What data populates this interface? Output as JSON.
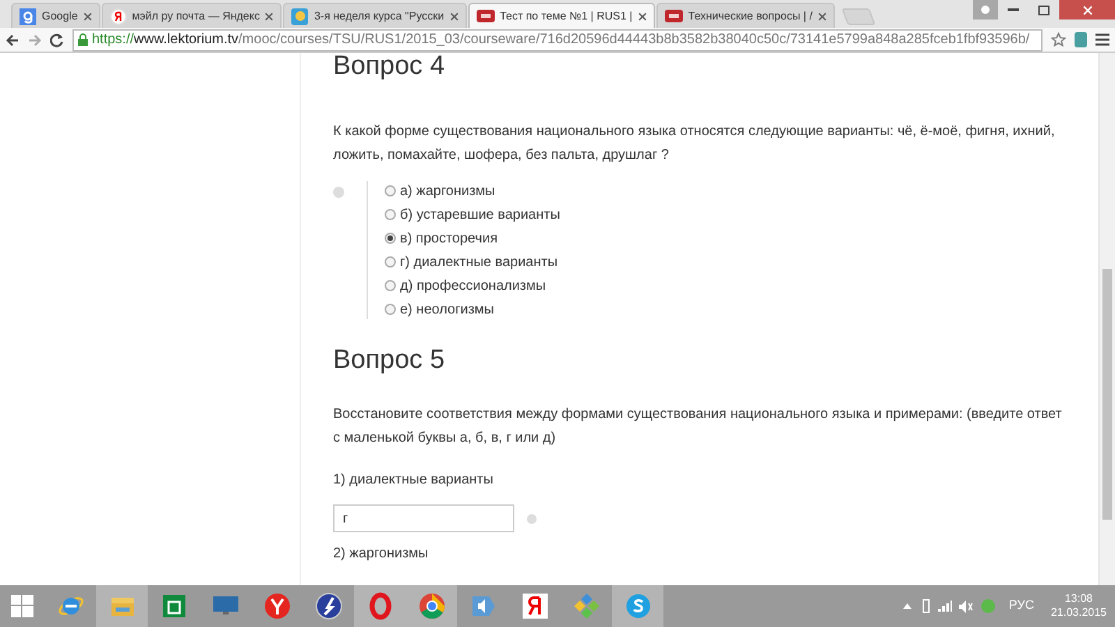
{
  "tabs": [
    {
      "title": "Google",
      "kind": "google",
      "selected": false
    },
    {
      "title": "мэйл ру почта — Яндекс",
      "kind": "yandex",
      "selected": false
    },
    {
      "title": "3-я неделя курса \"Русски",
      "kind": "course",
      "selected": false
    },
    {
      "title": "Тест по теме №1 | RUS1 |",
      "kind": "lektorium",
      "selected": true
    },
    {
      "title": "Технические вопросы | /",
      "kind": "lektorium",
      "selected": false
    }
  ],
  "address": {
    "scheme": "https://",
    "host": "www.lektorium.tv",
    "path": "/mooc/courses/TSU/RUS1/2015_03/courseware/716d20596d44443b8b3582b38040c50c/73141e5799a848a285fceb1fbf93596b/"
  },
  "questions": [
    {
      "title": "Вопрос 4",
      "kind": "choice",
      "text": "К какой форме существования национального языка относятся следующие варианты: чё, ё-моё, фигня, ихний, ложить, помахайте, шофера, без пальта, друшлаг ?",
      "options": [
        {
          "label": "а) жаргонизмы",
          "selected": false
        },
        {
          "label": "б) устаревшие варианты",
          "selected": false
        },
        {
          "label": "в) просторечия",
          "selected": true
        },
        {
          "label": "г) диалектные варианты",
          "selected": false
        },
        {
          "label": "д) профессионализмы",
          "selected": false
        },
        {
          "label": "е) неологизмы",
          "selected": false
        }
      ]
    },
    {
      "title": "Вопрос 5",
      "kind": "match",
      "text": "Восстановите соответствия между формами существования национального языка и примерами: (введите ответ с маленькой буквы а, б, в, г или д)",
      "items": [
        {
          "label": "1) диалектные варианты",
          "value": "г"
        },
        {
          "label": "2) жаргонизмы"
        }
      ]
    }
  ],
  "taskbar": [
    {
      "kind": "ie",
      "running": false
    },
    {
      "kind": "explorer",
      "running": true
    },
    {
      "kind": "store",
      "running": false
    },
    {
      "kind": "monitor",
      "running": false
    },
    {
      "kind": "yabrowser",
      "running": false
    },
    {
      "kind": "compass",
      "running": false
    },
    {
      "kind": "opera",
      "running": true
    },
    {
      "kind": "chrome",
      "running": true
    },
    {
      "kind": "speaker",
      "running": false
    },
    {
      "kind": "yandex",
      "running": false
    },
    {
      "kind": "diamonds",
      "running": false
    },
    {
      "kind": "skype",
      "running": true
    }
  ],
  "tray": {
    "language": "РУС",
    "time": "13:08",
    "date": "21.03.2015"
  }
}
